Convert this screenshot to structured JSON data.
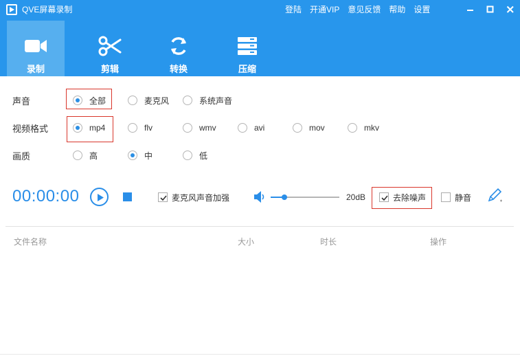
{
  "app": {
    "title": "QVE屏幕录制"
  },
  "top_links": [
    "登陆",
    "开通VIP",
    "意见反馈",
    "帮助",
    "设置"
  ],
  "window_controls": [
    "minimize-icon",
    "maximize-icon",
    "close-icon"
  ],
  "nav": [
    {
      "label": "录制",
      "icon": "video-camera-icon",
      "active": true
    },
    {
      "label": "剪辑",
      "icon": "scissors-icon",
      "active": false
    },
    {
      "label": "转换",
      "icon": "convert-arrows-icon",
      "active": false
    },
    {
      "label": "压缩",
      "icon": "compress-icon",
      "active": false
    }
  ],
  "options": {
    "sound": {
      "label": "声音",
      "choices": [
        "全部",
        "麦克风",
        "系统声音"
      ],
      "selected": "全部"
    },
    "format": {
      "label": "视频格式",
      "choices": [
        "mp4",
        "flv",
        "wmv",
        "avi",
        "mov",
        "mkv"
      ],
      "selected": "mp4"
    },
    "quality": {
      "label": "画质",
      "choices": [
        "高",
        "中",
        "低"
      ],
      "selected": "中"
    }
  },
  "controls": {
    "timer": "00:00:00",
    "mic_boost": {
      "label": "麦克风声音加强",
      "checked": true
    },
    "volume": {
      "value_text": "20dB",
      "level": 0.2
    },
    "denoise": {
      "label": "去除噪声",
      "checked": true
    },
    "mute": {
      "label": "静音",
      "checked": false
    }
  },
  "table": {
    "columns": [
      "文件名称",
      "大小",
      "时长",
      "操作"
    ]
  },
  "colors": {
    "primary": "#2896ec",
    "nav_active": "#56afef",
    "accent": "#2a8ee8",
    "highlight_box": "#d9362b"
  }
}
